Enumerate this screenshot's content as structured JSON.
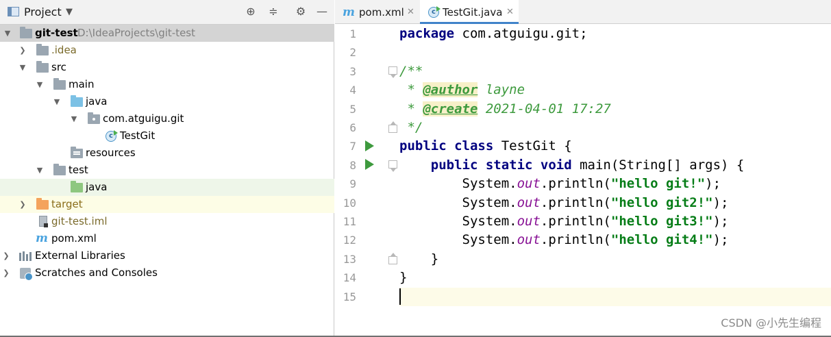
{
  "project_panel": {
    "title": "Project",
    "dropdown_icon": "chevron-down",
    "header_buttons": [
      "locate-icon",
      "collapse-all-icon",
      "gear-icon",
      "minimize-icon"
    ],
    "tree": [
      {
        "label": "git-test",
        "sublabel": "D:\\IdeaProjects\\git-test",
        "icon": "module-folder"
      },
      {
        "label": ".idea",
        "icon": "folder"
      },
      {
        "label": "src",
        "icon": "folder"
      },
      {
        "label": "main",
        "icon": "folder"
      },
      {
        "label": "java",
        "icon": "source-folder"
      },
      {
        "label": "com.atguigu.git",
        "icon": "package-folder"
      },
      {
        "label": "TestGit",
        "icon": "java-class"
      },
      {
        "label": "resources",
        "icon": "resources-folder"
      },
      {
        "label": "test",
        "icon": "folder"
      },
      {
        "label": "java",
        "icon": "test-source-folder"
      },
      {
        "label": "target",
        "icon": "excluded-folder"
      },
      {
        "label": "git-test.iml",
        "icon": "iml-file"
      },
      {
        "label": "pom.xml",
        "icon": "maven-file"
      },
      {
        "label": "External Libraries",
        "icon": "libraries"
      },
      {
        "label": "Scratches and Consoles",
        "icon": "scratches"
      }
    ]
  },
  "editor": {
    "tabs": [
      {
        "label": "pom.xml",
        "icon": "maven-icon",
        "active": false
      },
      {
        "label": "TestGit.java",
        "icon": "java-class-icon",
        "active": true
      }
    ],
    "line_numbers": [
      "1",
      "2",
      "3",
      "4",
      "5",
      "6",
      "7",
      "8",
      "9",
      "10",
      "11",
      "12",
      "13",
      "14",
      "15"
    ],
    "code": {
      "l1_kw": "package",
      "l1_rest": " com.atguigu.git;",
      "l3": "/**",
      "l4_star": " * ",
      "l4_tag": "@author",
      "l4_val": " layne",
      "l5_star": " * ",
      "l5_tag": "@create",
      "l5_val": " 2021-04-01 17:27",
      "l6": " */",
      "l7_kw": "public class",
      "l7_rest": " TestGit {",
      "l8_indent": "    ",
      "l8_kw": "public static void",
      "l8_rest": " main(String[] args) {",
      "println_prefix": "        System.",
      "out": "out",
      "println_mid": ".println(",
      "s1": "\"hello git!\"",
      "s2": "\"hello git2!\"",
      "s3": "\"hello git3!\"",
      "s4": "\"hello git4!\"",
      "println_end": ");",
      "l13": "    }",
      "l14": "}"
    }
  },
  "watermark": "CSDN @小先生编程"
}
